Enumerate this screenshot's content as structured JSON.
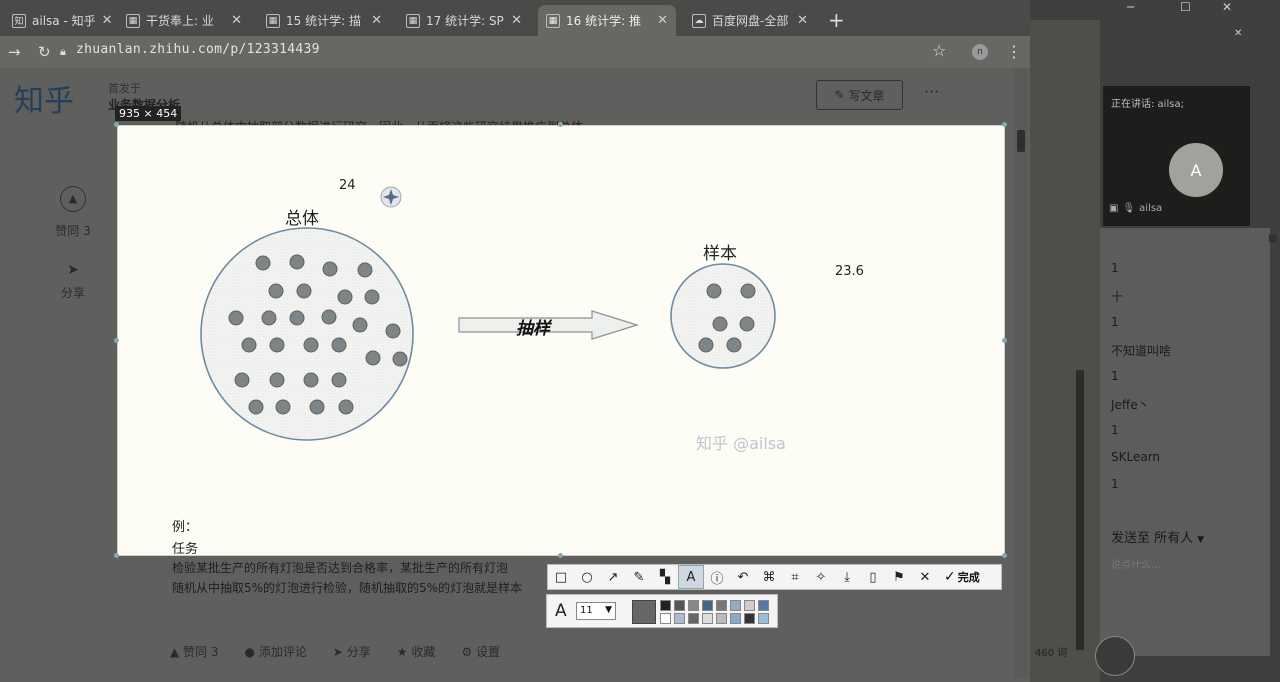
{
  "tabs": [
    {
      "title": "ailsa - 知乎"
    },
    {
      "title": "干货奉上: 业"
    },
    {
      "title": "15 统计学: 描"
    },
    {
      "title": "17 统计学: SP"
    },
    {
      "title": "16 统计学: 推"
    },
    {
      "title": "百度网盘-全部"
    }
  ],
  "address": {
    "url": "zhuanlan.zhihu.com/p/123314439"
  },
  "page": {
    "logo": "知乎",
    "author": "首发于",
    "column_title": "业务数据分析",
    "truncated_line": "随机从总体中抽取部分数据进行研究，因此，从而将这些研究结果推广到总体",
    "write_button": "写文章",
    "more": "···",
    "agree": "赞同 3",
    "share": "分享",
    "bottom": {
      "agree": "赞同 3",
      "comment": "添加评论",
      "share": "分享",
      "collect": "收藏",
      "settings": "设置"
    },
    "para_line1": "检验某批生产的所有灯泡是否达到合格率，某批生产的所有灯泡",
    "para_line2": "随机从中抽取5%的灯泡进行检验，随机抽取的5%的灯泡就是样本"
  },
  "capture": {
    "size_label": "935 × 454",
    "population_label": "总体",
    "sample_label": "样本",
    "arrow_label": "抽样",
    "annotation_1": "24",
    "annotation_2": "23.6",
    "watermark": "知乎 @ailsa",
    "example": "例：",
    "task": "任务"
  },
  "toolbar": {
    "finish": "完成",
    "font_size": "11"
  },
  "colors": {
    "swatches": [
      "#222222",
      "#555555",
      "#888888",
      "#446688",
      "#777777",
      "#99aabb",
      "#cccccc",
      "#5577aa",
      "#ffffff",
      "#aabbcc",
      "#666666",
      "#dddddd",
      "#bbbbbb",
      "#88aacc",
      "#333333",
      "#99bbdd"
    ]
  },
  "meeting": {
    "speaking": "正在讲话: ailsa;",
    "avatar": "A",
    "user": "ailsa"
  },
  "chat": {
    "lines": [
      "1",
      "十",
      "1",
      "不知道叫啥",
      "1",
      "Jeffe丶",
      "1",
      "SKLearn",
      "1"
    ],
    "send_to": "发送至 所有人",
    "input_hint": "说点什么…",
    "word_count": "460 词"
  }
}
